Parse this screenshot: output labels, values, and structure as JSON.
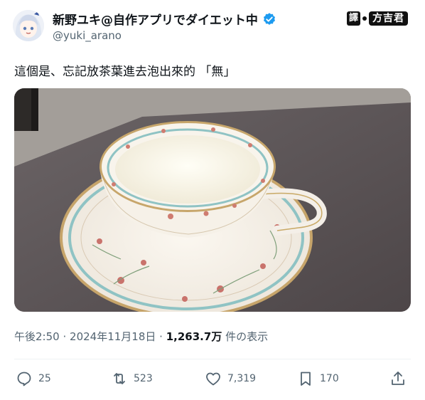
{
  "author": {
    "display_name": "新野ユキ@自作アプリでダイエット中",
    "handle": "@yuki_arano",
    "avatar_icon": "anime-avatar-icon",
    "verified_icon": "verified-badge-icon",
    "verified_color": "#1d9bf0"
  },
  "translator_badge": {
    "char": "譯",
    "name": "方吉君"
  },
  "tweet": {
    "text": "這個是、忘記放茶葉進去泡出來的 「無」",
    "time": "午後2:50",
    "sep1": "·",
    "date": "2024年11月18日",
    "sep2": "·",
    "views": "1,263.7万",
    "views_suffix": "件の表示"
  },
  "actions": {
    "replies": "25",
    "reposts": "523",
    "likes": "7,319",
    "bookmarks": "170"
  },
  "colors": {
    "text": "#0f1419",
    "secondary": "#536471",
    "divider": "#eff3f4"
  }
}
